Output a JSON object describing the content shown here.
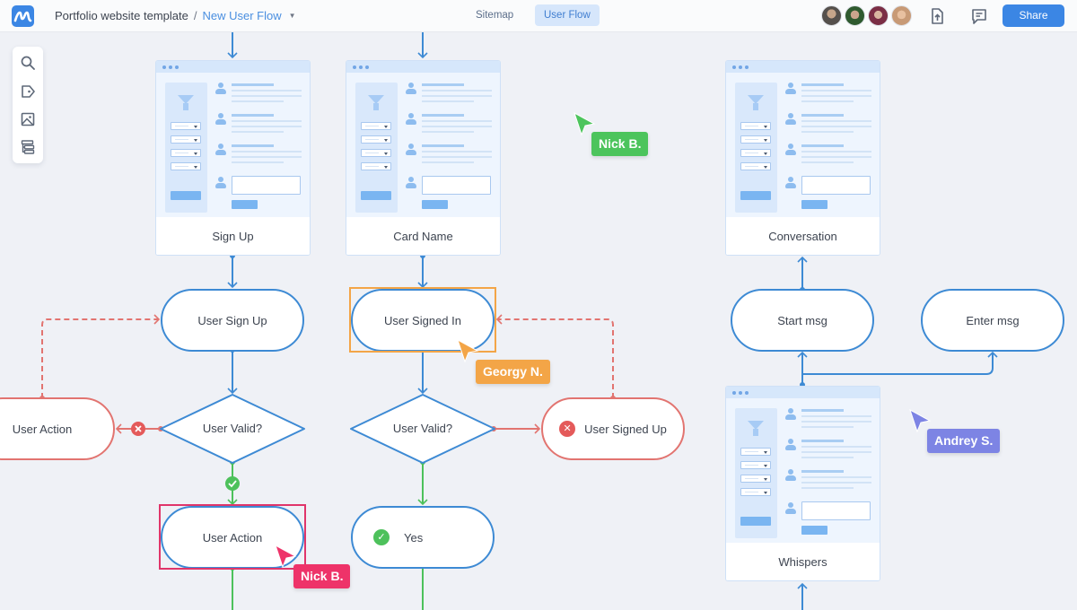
{
  "header": {
    "project": "Portfolio website template",
    "separator": "/",
    "current_flow": "New User Flow",
    "tabs": [
      {
        "label": "Sitemap",
        "active": false
      },
      {
        "label": "User Flow",
        "active": true
      }
    ],
    "collaborators": [
      "collaborator-1",
      "collaborator-2",
      "collaborator-3",
      "collaborator-4"
    ],
    "share_label": "Share"
  },
  "toolbar": {
    "tools": [
      "search-icon",
      "tag-icon",
      "image-icon",
      "sitemap-icon"
    ]
  },
  "colors": {
    "brand": "#3b86e4",
    "flow_blue": "#3d8ad4",
    "error_red": "#e27470",
    "success_green": "#4dc15b",
    "canvas": "#eff1f6"
  },
  "screens": [
    {
      "id": "sign-up",
      "label": "Sign Up"
    },
    {
      "id": "card-name",
      "label": "Card Name"
    },
    {
      "id": "conversation",
      "label": "Conversation"
    },
    {
      "id": "whispers",
      "label": "Whispers"
    }
  ],
  "nodes": {
    "user_sign_up": "User Sign Up",
    "user_signed_in": "User Signed In",
    "user_action_left": "User Action",
    "user_valid_left": "User Valid?",
    "user_valid_right": "User Valid?",
    "user_signed_up": "User Signed Up",
    "user_action": "User Action",
    "yes": "Yes",
    "start_msg": "Start msg",
    "enter_msg": "Enter msg"
  },
  "cursors": [
    {
      "name": "Nick B.",
      "color": "#4cc45c"
    },
    {
      "name": "Georgy N.",
      "color": "#f3a547"
    },
    {
      "name": "Andrey S.",
      "color": "#7d84e4"
    },
    {
      "name": "Nick B.",
      "color": "#ee3369"
    }
  ]
}
